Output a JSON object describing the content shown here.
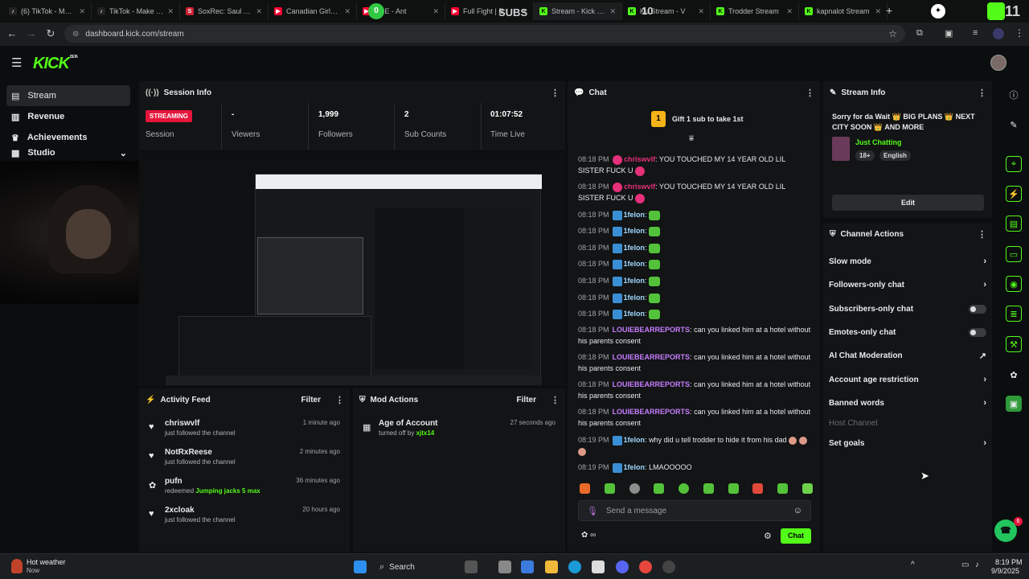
{
  "browser": {
    "tabs": [
      {
        "label": "(6) TikTok - Make",
        "icon": "tiktok-icon",
        "color": "#111111"
      },
      {
        "label": "TikTok - Make Yo",
        "icon": "tiktok-icon",
        "color": "#111111"
      },
      {
        "label": "SoxRec: Saul Alva",
        "icon": "soxrec-icon",
        "color": "#cc2233"
      },
      {
        "label": "Canadian Girls Re",
        "icon": "youtube-icon",
        "color": "#ff0033"
      },
      {
        "label": "RBE - Ant",
        "icon": "youtube-icon",
        "color": "#ff0033"
      },
      {
        "label": "Full Fight | B",
        "icon": "youtube-icon",
        "color": "#ff0033"
      },
      {
        "label": "Stream - Kick Da",
        "icon": "kick-icon",
        "color": "#53fc18"
      },
      {
        "label": "Ku Stream - V",
        "icon": "kick-icon",
        "color": "#53fc18"
      },
      {
        "label": "Trodder Stream",
        "icon": "kick-icon",
        "color": "#53fc18"
      },
      {
        "label": "kapnalot Stream",
        "icon": "kick-icon",
        "color": "#53fc18"
      }
    ],
    "overlay_subs": "SUBS",
    "overlay_count_left": "0",
    "overlay_count_right": "10",
    "overlay_corner": "11",
    "url": "dashboard.kick.com/stream"
  },
  "kick": {
    "logo": "KICK",
    "logo_sup": "BETA",
    "sidebar": [
      {
        "label": "Stream",
        "icon": "stream-icon"
      },
      {
        "label": "Revenue",
        "icon": "revenue-icon"
      },
      {
        "label": "Achievements",
        "icon": "trophy-icon"
      },
      {
        "label": "Studio",
        "icon": "studio-icon"
      }
    ]
  },
  "session": {
    "title": "Session Info",
    "status": "STREAMING",
    "status_label": "Session",
    "stats": [
      {
        "value": "-",
        "label": "Viewers"
      },
      {
        "value": "1,999",
        "label": "Followers"
      },
      {
        "value": "2",
        "label": "Sub Counts"
      },
      {
        "value": "01:07:52",
        "label": "Time Live"
      }
    ]
  },
  "activity": {
    "title": "Activity Feed",
    "filter": "Filter",
    "items": [
      {
        "icon": "heart-icon",
        "name": "chriswvlf",
        "sub": "just followed the channel",
        "time": "1 minute ago"
      },
      {
        "icon": "heart-icon",
        "name": "NotRxReese",
        "sub": "just followed the channel",
        "time": "2 minutes ago"
      },
      {
        "icon": "redeem-icon",
        "name": "pufn",
        "sub_prefix": "redeemed ",
        "sub_highlight": "Jumping jacks 5 max",
        "time": "36 minutes ago"
      },
      {
        "icon": "heart-icon",
        "name": "2xcloak",
        "sub": "just followed the channel",
        "time": "20 hours ago"
      }
    ]
  },
  "mod": {
    "title": "Mod Actions",
    "filter": "Filter",
    "items": [
      {
        "title": "Age of Account",
        "sub_prefix": "turned off by ",
        "sub_user": "xjtx14",
        "time": "27 seconds ago"
      }
    ]
  },
  "chat": {
    "title": "Chat",
    "gift": "Gift 1 sub to take 1st",
    "gift_rank": "1",
    "messages": [
      {
        "time": "08:18 PM",
        "user": "chriswvlf",
        "color": "#e5307a",
        "text": "YOU TOUCHED MY 14 YEAR OLD LIL SISTER FUCK U"
      },
      {
        "time": "08:18 PM",
        "user": "chriswvlf",
        "color": "#e5307a",
        "text": "YOU TOUCHED MY 14 YEAR OLD LIL SISTER FUCK U"
      },
      {
        "time": "08:18 PM",
        "user": "1felon",
        "color": "#a1d8ff",
        "text": ""
      },
      {
        "time": "08:18 PM",
        "user": "1felon",
        "color": "#a1d8ff",
        "text": ""
      },
      {
        "time": "08:18 PM",
        "user": "1felon",
        "color": "#a1d8ff",
        "text": ""
      },
      {
        "time": "08:18 PM",
        "user": "1felon",
        "color": "#a1d8ff",
        "text": ""
      },
      {
        "time": "08:18 PM",
        "user": "1felon",
        "color": "#a1d8ff",
        "text": ""
      },
      {
        "time": "08:18 PM",
        "user": "1felon",
        "color": "#a1d8ff",
        "text": ""
      },
      {
        "time": "08:18 PM",
        "user": "1felon",
        "color": "#a1d8ff",
        "text": ""
      },
      {
        "time": "08:18 PM",
        "user": "LOUIEBEARREPORTS",
        "color": "#c77dff",
        "text": "can you linked him at a hotel without his parents consent"
      },
      {
        "time": "08:18 PM",
        "user": "LOUIEBEARREPORTS",
        "color": "#c77dff",
        "text": "can you linked him at a hotel without his parents consent"
      },
      {
        "time": "08:18 PM",
        "user": "LOUIEBEARREPORTS",
        "color": "#c77dff",
        "text": "can you linked him at a hotel without his parents consent"
      },
      {
        "time": "08:18 PM",
        "user": "LOUIEBEARREPORTS",
        "color": "#c77dff",
        "text": "can you linked him at a hotel without his parents consent"
      },
      {
        "time": "08:19 PM",
        "user": "1felon",
        "color": "#a1d8ff",
        "text": "why did u tell trodder to hide it from his dad"
      },
      {
        "time": "08:19 PM",
        "user": "1felon",
        "color": "#a1d8ff",
        "text": "LMAOOOOO"
      }
    ],
    "input_placeholder": "Send a message",
    "send": "Chat"
  },
  "stream_info": {
    "title": "Stream Info",
    "stream_title": "Sorry for da Wait 👑 BIG PLANS 👑 NEXT CITY SOON 👑 AND MORE",
    "category": "Just Chatting",
    "tags": [
      "18+",
      "English"
    ],
    "edit": "Edit"
  },
  "channel_actions": {
    "title": "Channel Actions",
    "items": [
      {
        "label": "Slow mode",
        "control": "chevron"
      },
      {
        "label": "Followers-only chat",
        "control": "chevron"
      },
      {
        "label": "Subscribers-only chat",
        "control": "toggle"
      },
      {
        "label": "Emotes-only chat",
        "control": "toggle"
      },
      {
        "label": "AI Chat Moderation",
        "control": "external"
      },
      {
        "label": "Account age restriction",
        "control": "chevron"
      },
      {
        "label": "Banned words",
        "control": "chevron"
      },
      {
        "label": "Host Channel",
        "control": "none",
        "disabled": true
      },
      {
        "label": "Set goals",
        "control": "chevron"
      }
    ]
  },
  "taskbar": {
    "weather_title": "Hot weather",
    "weather_sub": "Now",
    "search": "Search",
    "time": "8:19 PM",
    "date": "9/9/2025",
    "floating_badge": "6"
  },
  "colors": {
    "brand": "#53fc18",
    "streaming": "#e5153b"
  }
}
